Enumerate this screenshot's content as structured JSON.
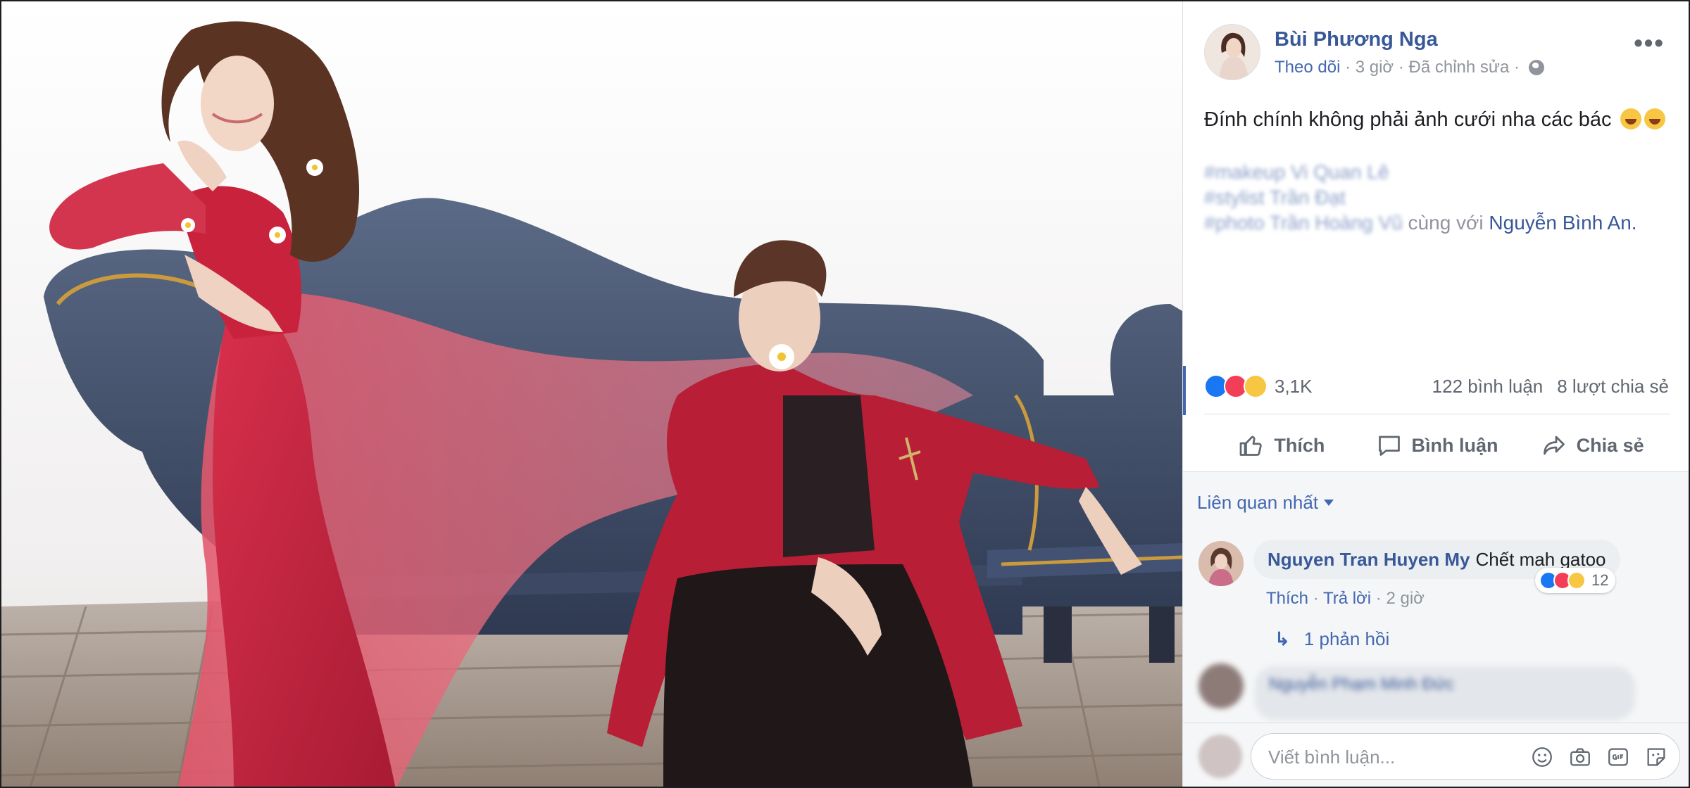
{
  "post": {
    "author": "Bùi Phương Nga",
    "follow": "Theo dõi",
    "time": "3 giờ",
    "edited": "Đã chỉnh sửa",
    "sep": " · ",
    "text": "Đính chính không phải ảnh cưới nha các bác",
    "credits": [
      "#makeup Vi Quan Lê",
      "#stylist Trần Đạt",
      "#photo Trần Hoàng Vũ"
    ],
    "with_text": "cùng với",
    "tagged": "Nguyễn Bình An."
  },
  "stats": {
    "reactions": "3,1K",
    "comments": "122 bình luận",
    "shares": "8 lượt chia sẻ"
  },
  "actions": {
    "like": "Thích",
    "comment": "Bình luận",
    "share": "Chia sẻ"
  },
  "comments": {
    "sort_label": "Liên quan nhất",
    "first": {
      "name": "Nguyen Tran Huyen My",
      "text": "Chết mah gatoo",
      "react_count": "12",
      "like": "Thích",
      "reply": "Trả lời",
      "time": "2 giờ"
    },
    "replies_label": "1 phản hồi",
    "second_preview": "Nguyễn Phạm Minh Đức",
    "composer_placeholder": "Viết bình luận..."
  },
  "colors": {
    "link": "#385898",
    "accent": "#4267b2",
    "muted": "#90949c",
    "dress": "#c4243f"
  },
  "icons": [
    "more-icon",
    "globe-icon",
    "like-icon",
    "comment-icon",
    "share-icon",
    "emoji-icon",
    "camera-icon",
    "gif-icon",
    "sticker-icon"
  ]
}
